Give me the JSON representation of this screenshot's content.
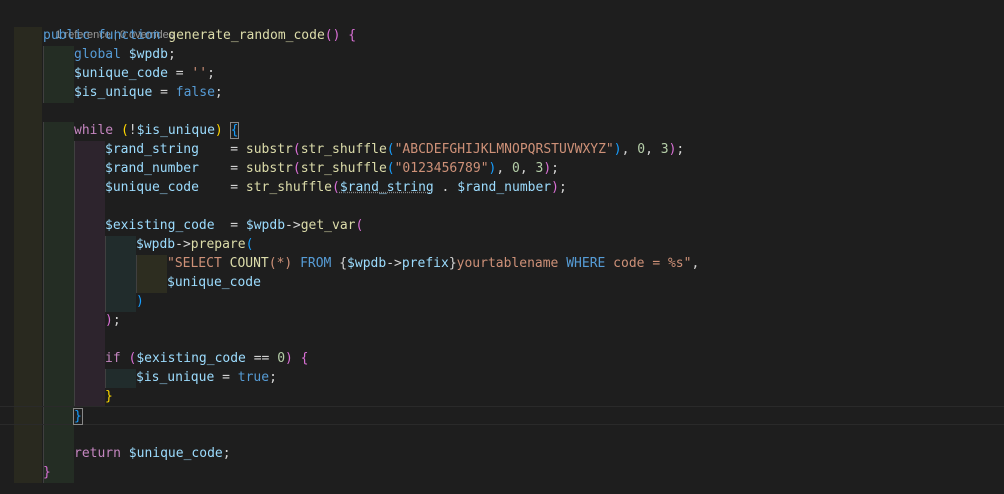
{
  "codelens": {
    "references": "1 reference",
    "separator": " | ",
    "overrides": "0 overrides"
  },
  "lines": {
    "l1": {
      "public": "public",
      "function": "function",
      "name": "generate_random_code",
      "open": "(",
      "close": ")",
      "brace": "{"
    },
    "l2": {
      "global": "global",
      "var": "$wpdb",
      "semi": ";"
    },
    "l3": {
      "var": "$unique_code",
      "eq": " = ",
      "str": "''",
      "semi": ";"
    },
    "l4": {
      "var": "$is_unique",
      "eq": " = ",
      "val": "false",
      "semi": ";"
    },
    "l6": {
      "while": "while",
      "open": " (",
      "not": "!",
      "var": "$is_unique",
      "close": ")",
      "brace": "{"
    },
    "l7": {
      "var": "$rand_string",
      "eq": "    = ",
      "fn1": "substr",
      "p1": "(",
      "fn2": "str_shuffle",
      "p2": "(",
      "str": "\"ABCDEFGHIJKLMNOPQRSTUVWXYZ\"",
      "p2c": ")",
      "rest1": ", ",
      "n1": "0",
      "rest2": ", ",
      "n2": "3",
      "p1c": ")",
      "semi": ";"
    },
    "l8": {
      "var": "$rand_number",
      "eq": "    = ",
      "fn1": "substr",
      "p1": "(",
      "fn2": "str_shuffle",
      "p2": "(",
      "str": "\"0123456789\"",
      "p2c": ")",
      "rest1": ", ",
      "n1": "0",
      "rest2": ", ",
      "n2": "3",
      "p1c": ")",
      "semi": ";"
    },
    "l9": {
      "var": "$unique_code",
      "eq": "    = ",
      "fn": "str_shuffle",
      "p": "(",
      "v1": "$rand_string",
      "dot": " . ",
      "v2": "$rand_number",
      "pc": ")",
      "semi": ";"
    },
    "l11": {
      "var": "$existing_code",
      "eq": "  = ",
      "v": "$wpdb",
      "arrow": "->",
      "fn": "get_var",
      "p": "("
    },
    "l12": {
      "v": "$wpdb",
      "arrow": "->",
      "fn": "prepare",
      "p": "("
    },
    "l13": {
      "s1": "\"SELECT ",
      "fn": "COUNT",
      "s2": "(*) ",
      "kw1": "FROM",
      "sp": " ",
      "open": "{",
      "v": "$wpdb",
      "arrow": "->",
      "prop": "prefix",
      "close": "}",
      "s3": "yourtablename ",
      "kw2": "WHERE",
      "s4": " code = %s\"",
      "comma": ","
    },
    "l14": {
      "v": "$unique_code"
    },
    "l15": {
      "pc": ")"
    },
    "l16": {
      "pc": ")",
      "semi": ";"
    },
    "l18": {
      "if": "if",
      "open": " (",
      "v": "$existing_code",
      "eq": " == ",
      "n": "0",
      "close": ")",
      "brace": " {"
    },
    "l19": {
      "v": "$is_unique",
      "eq": " = ",
      "val": "true",
      "semi": ";"
    },
    "l20": {
      "brace": "}"
    },
    "l21": {
      "brace": "}"
    },
    "l23": {
      "return": "return",
      "v": "$unique_code",
      "semi": ";"
    },
    "l24": {
      "brace": "}"
    }
  }
}
